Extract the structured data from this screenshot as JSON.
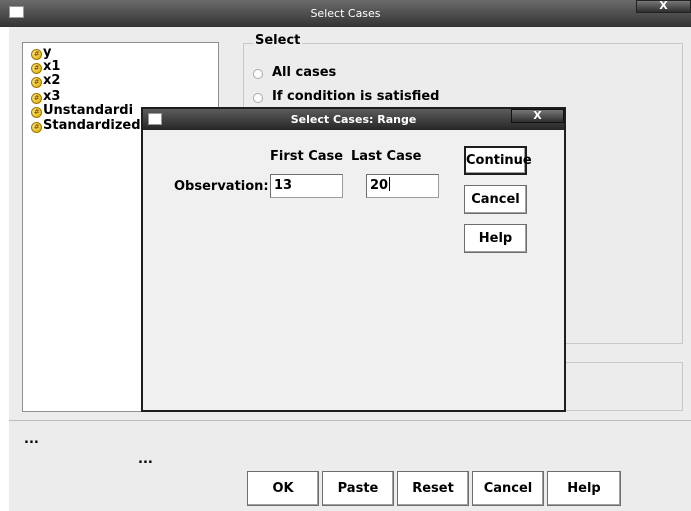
{
  "main_window": {
    "title": "Select Cases",
    "close_label": "X",
    "variables": [
      {
        "label": "y",
        "icon": "scale-variable-icon"
      },
      {
        "label": "x1",
        "icon": "scale-variable-icon"
      },
      {
        "label": "x2",
        "icon": "scale-variable-icon"
      },
      {
        "label": "x3",
        "icon": "scale-variable-icon"
      },
      {
        "label": "Unstandardi",
        "icon": "scale-variable-icon"
      },
      {
        "label": "Standardized",
        "icon": "scale-variable-icon"
      }
    ],
    "select_group": {
      "legend": "Select",
      "options": [
        {
          "label": "All cases"
        },
        {
          "label": "If condition is satisfied"
        }
      ]
    },
    "ellipsis_1": "...",
    "ellipsis_2": "...",
    "buttons": {
      "ok": "OK",
      "paste": "Paste",
      "reset": "Reset",
      "cancel": "Cancel",
      "help": "Help"
    }
  },
  "range_dialog": {
    "title": "Select Cases: Range",
    "close_label": "X",
    "first_case_header": "First Case",
    "last_case_header": "Last Case",
    "observation_label": "Observation:",
    "first_case_value": "13",
    "last_case_value": "20",
    "buttons": {
      "continue": "Continue",
      "cancel": "Cancel",
      "help": "Help"
    }
  },
  "colors": {
    "titlebar": "#333333",
    "dialog_background": "#f0f0f0",
    "variable_icon": "#d4a000"
  }
}
